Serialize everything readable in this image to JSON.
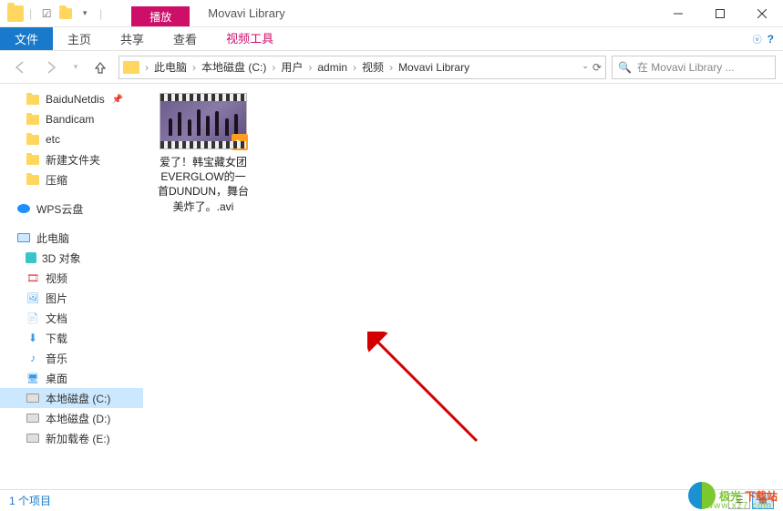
{
  "titlebar": {
    "context_tab_label": "播放",
    "window_title": "Movavi Library"
  },
  "ribbon": {
    "file": "文件",
    "home": "主页",
    "share": "共享",
    "view": "查看",
    "video_tools": "视频工具"
  },
  "breadcrumb": {
    "items": [
      "此电脑",
      "本地磁盘 (C:)",
      "用户",
      "admin",
      "视频",
      "Movavi Library"
    ]
  },
  "search": {
    "placeholder": "在 Movavi Library ..."
  },
  "nav": {
    "items": [
      {
        "label": "BaiduNetdis",
        "icon": "folder",
        "pin": true
      },
      {
        "label": "Bandicam",
        "icon": "folder"
      },
      {
        "label": "etc",
        "icon": "folder"
      },
      {
        "label": "新建文件夹",
        "icon": "folder"
      },
      {
        "label": "压缩",
        "icon": "folder"
      }
    ],
    "cloud": "WPS云盘",
    "pc": "此电脑",
    "pc_items": [
      {
        "label": "3D 对象",
        "icon": "3d"
      },
      {
        "label": "视频",
        "icon": "vid"
      },
      {
        "label": "图片",
        "icon": "pic"
      },
      {
        "label": "文档",
        "icon": "doc"
      },
      {
        "label": "下载",
        "icon": "dl"
      },
      {
        "label": "音乐",
        "icon": "music"
      },
      {
        "label": "桌面",
        "icon": "desk"
      },
      {
        "label": "本地磁盘 (C:)",
        "icon": "drive",
        "selected": true
      },
      {
        "label": "本地磁盘 (D:)",
        "icon": "drive"
      },
      {
        "label": "新加载卷 (E:)",
        "icon": "drive"
      }
    ]
  },
  "file": {
    "name": "爱了！韩宝藏女团EVERGLOW的一首DUNDUN，舞台美炸了。.avi"
  },
  "status": {
    "count": "1 个项目"
  },
  "watermark": {
    "text1": "极光",
    "text2": "下载站",
    "url": "www.xz7.com"
  }
}
